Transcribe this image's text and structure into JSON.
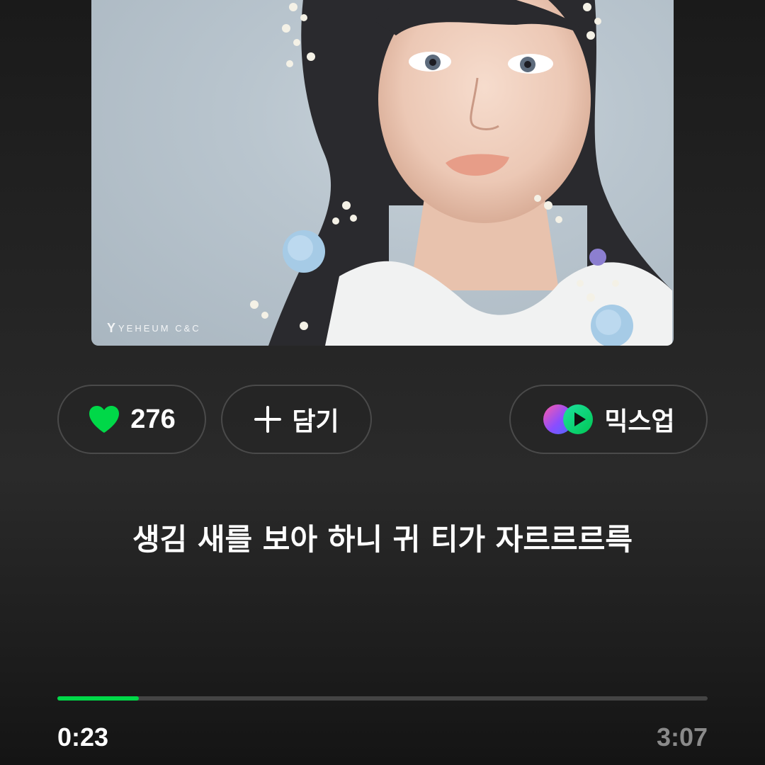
{
  "album": {
    "watermark_mark": "Y",
    "watermark_text": "YEHEUM C&C"
  },
  "actions": {
    "like_count": "276",
    "add_label": "담기",
    "mixup_label": "믹스업"
  },
  "lyric": {
    "current_line": "생김 새를 보아 하니 귀 티가 자르르르륵"
  },
  "player": {
    "elapsed": "0:23",
    "duration": "3:07",
    "progress_fraction": 0.125
  },
  "colors": {
    "accent": "#00d848",
    "track": "#444444",
    "pill_border": "#4a4a4a",
    "total_time": "#8a8a8a"
  },
  "icons": {
    "like": "heart-icon",
    "add": "plus-icon",
    "mixup": "mixup-icon"
  }
}
